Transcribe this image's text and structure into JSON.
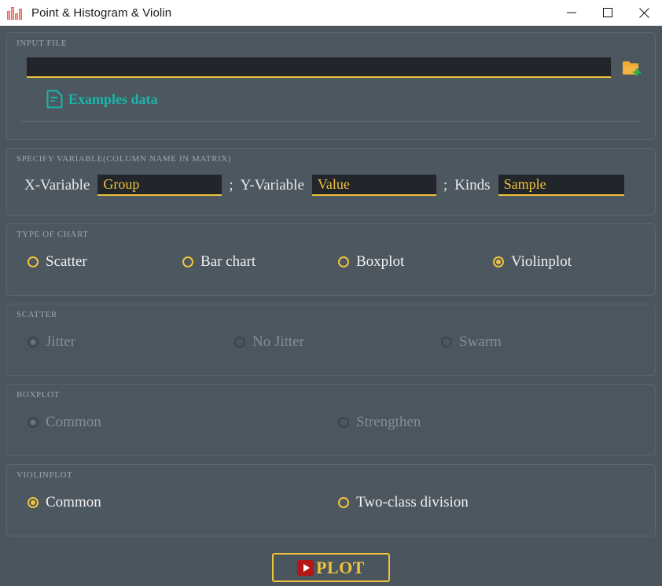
{
  "window": {
    "title": "Point & Histogram & Violin",
    "icon": "bar-chart-icon",
    "controls": {
      "minimize": "minimize-icon",
      "maximize": "maximize-icon",
      "close": "close-icon"
    },
    "accent_yellow": "#f0c33c",
    "accent_teal": "#19b6ac",
    "accent_red": "#b51616",
    "panel_bg": "#4d575f",
    "page_bg": "#4b555e"
  },
  "input_file": {
    "title": "Input File",
    "path_value": "",
    "path_placeholder": "",
    "browse_icon": "folder-add-icon",
    "examples": {
      "icon": "file-document-icon",
      "label": "Examples data"
    }
  },
  "variables": {
    "title": "Specify Variable(Column Name In Matrix)",
    "fields": [
      {
        "label": "X-Variable",
        "value": "Group",
        "name": "x-variable"
      },
      {
        "label": "Y-Variable",
        "value": "Value",
        "name": "y-variable"
      },
      {
        "label": "Kinds",
        "value": "Sample",
        "name": "kinds"
      }
    ],
    "separator": ";"
  },
  "chart_type": {
    "title": "Type Of Chart",
    "enabled": true,
    "selected": "Violinplot",
    "options": [
      {
        "label": "Scatter",
        "checked": false
      },
      {
        "label": "Bar chart",
        "checked": false
      },
      {
        "label": "Boxplot",
        "checked": false
      },
      {
        "label": "Violinplot",
        "checked": true
      }
    ]
  },
  "scatter": {
    "title": "Scatter",
    "enabled": false,
    "selected": "Jitter",
    "options": [
      {
        "label": "Jitter",
        "checked": true
      },
      {
        "label": "No Jitter",
        "checked": false
      },
      {
        "label": "Swarm",
        "checked": false
      }
    ]
  },
  "boxplot": {
    "title": "Boxplot",
    "enabled": false,
    "selected": "Common",
    "options": [
      {
        "label": "Common",
        "checked": true
      },
      {
        "label": "Strengthen",
        "checked": false
      }
    ]
  },
  "violinplot": {
    "title": "Violinplot",
    "enabled": true,
    "selected": "Common",
    "options": [
      {
        "label": "Common",
        "checked": true
      },
      {
        "label": "Two-class division",
        "checked": false
      }
    ]
  },
  "plot_button": {
    "label": "PLOT",
    "icon": "play-icon"
  }
}
